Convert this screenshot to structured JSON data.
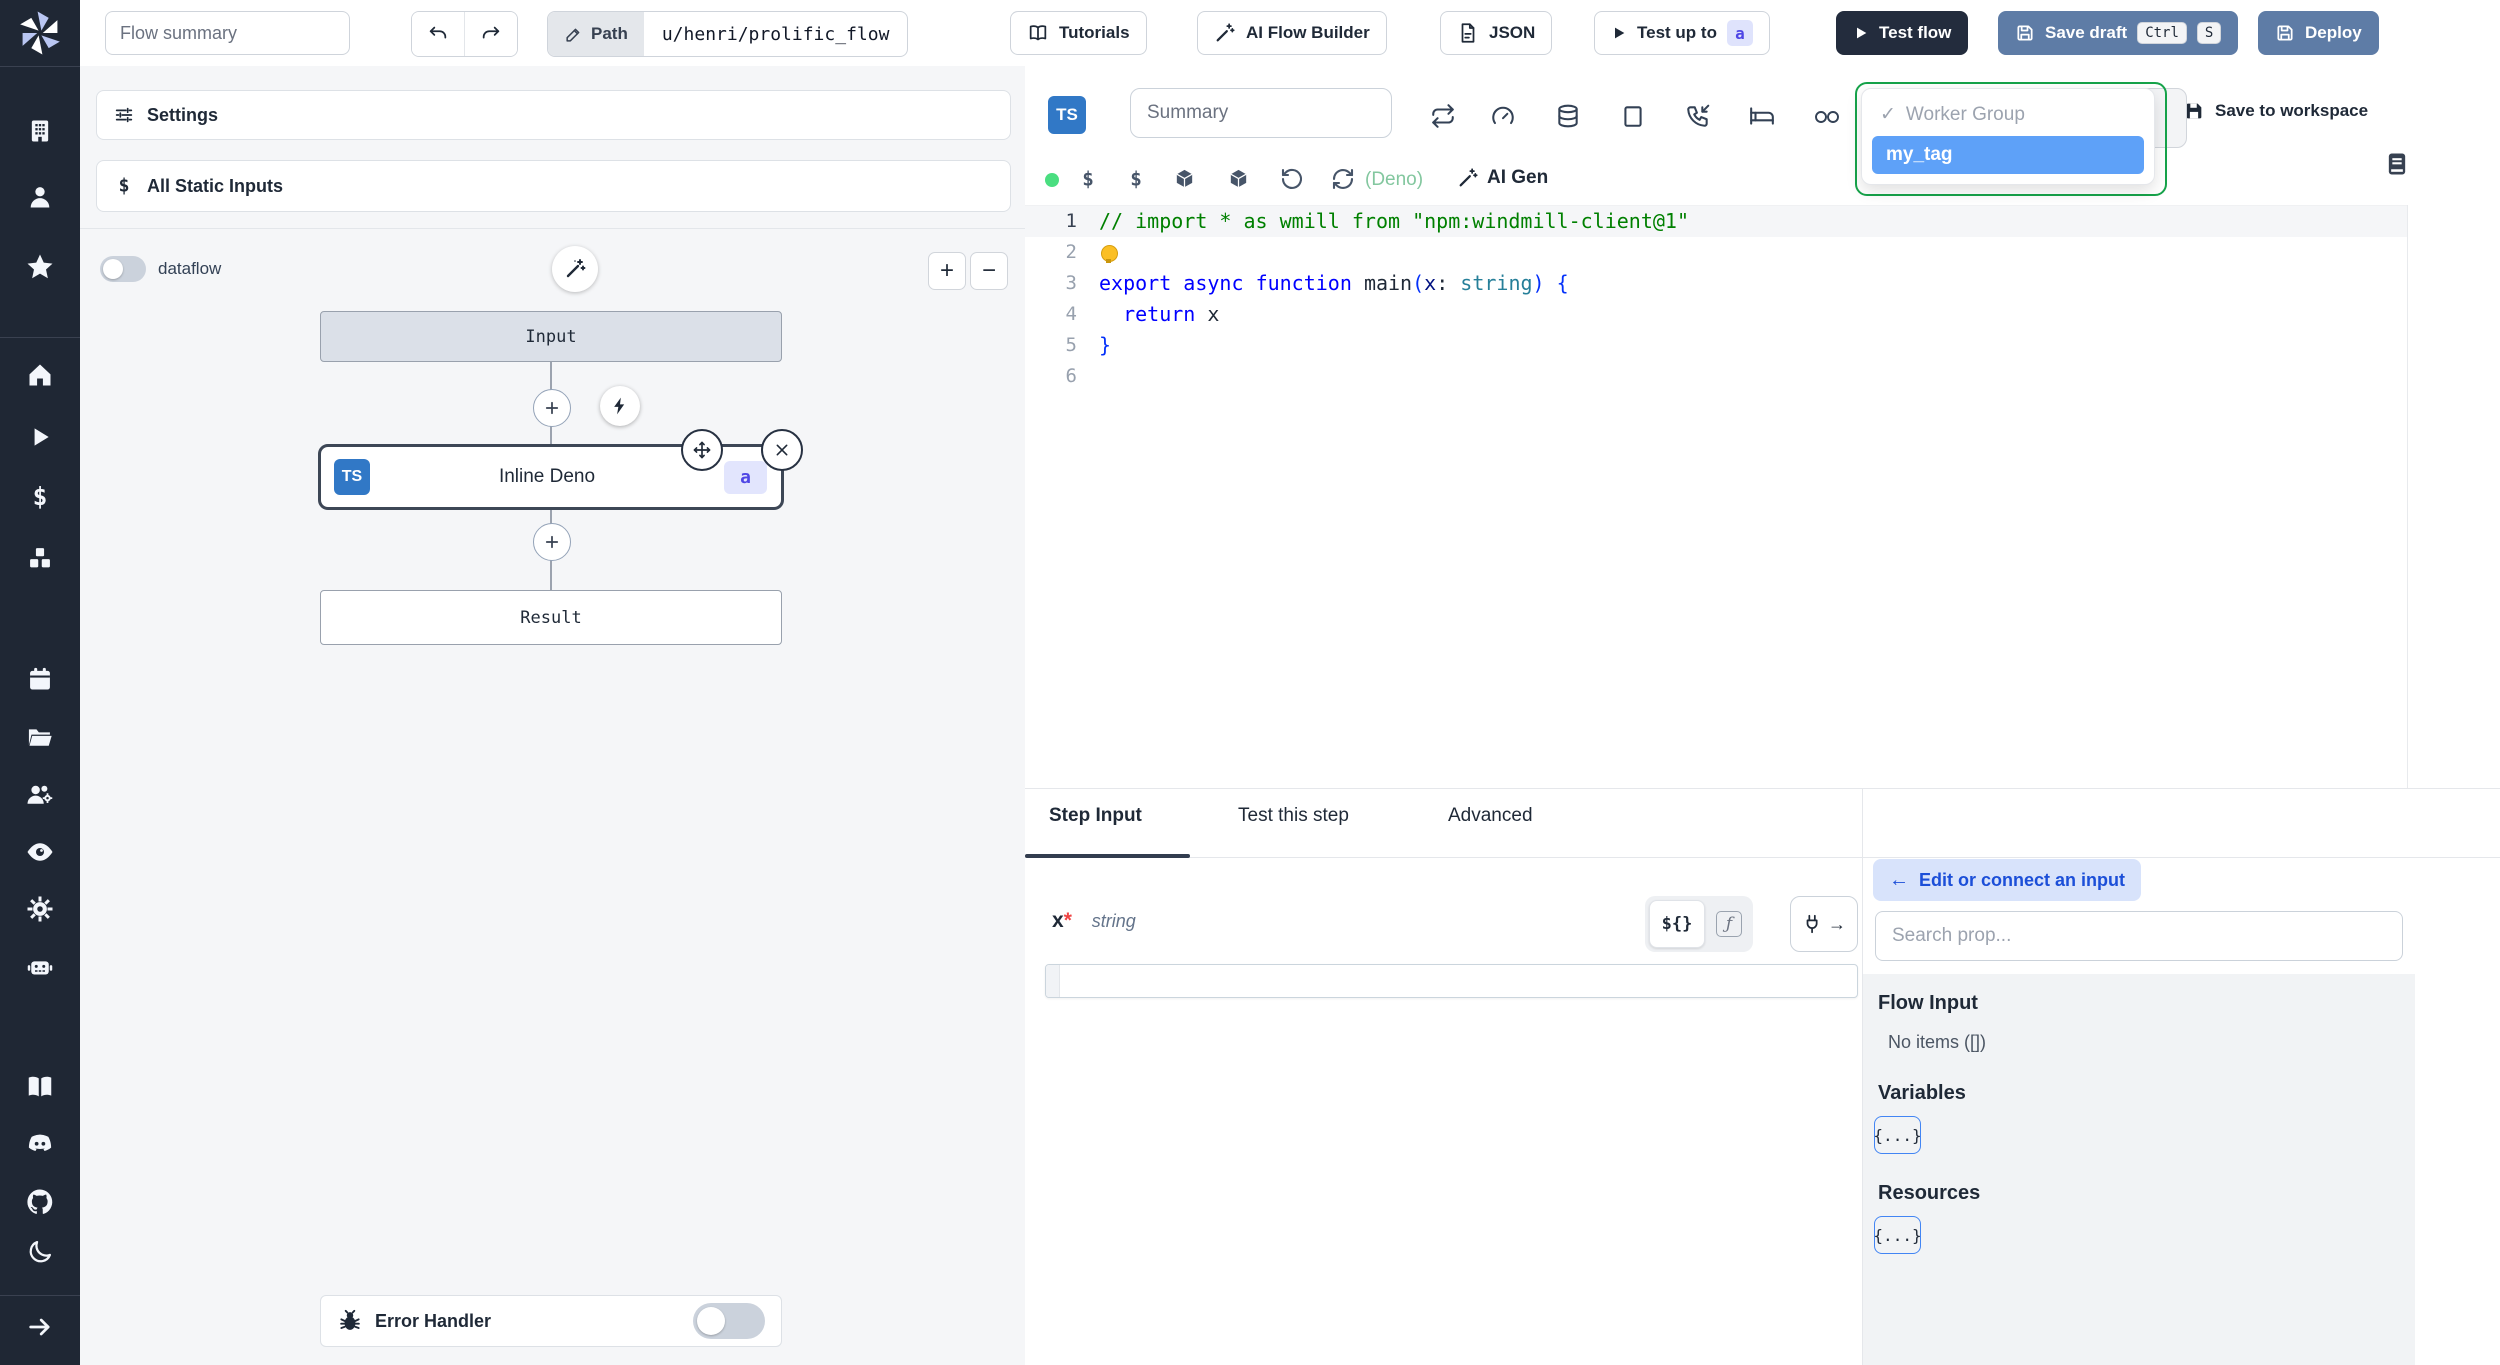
{
  "topbar": {
    "flow_summary_placeholder": "Flow summary",
    "path_label": "Path",
    "path_value": "u/henri/prolific_flow",
    "tutorials_label": "Tutorials",
    "ai_flow_builder_label": "AI Flow Builder",
    "json_label": "JSON",
    "test_up_to_label": "Test up to",
    "test_up_to_badge": "a",
    "test_flow_label": "Test flow",
    "save_draft_label": "Save draft",
    "save_draft_kbd": [
      "Ctrl",
      "S"
    ],
    "deploy_label": "Deploy"
  },
  "sidebar": {
    "icons": [
      "windmill-logo",
      "building",
      "user",
      "star",
      "home",
      "play",
      "dollar",
      "boxes",
      "calendar",
      "folder-open",
      "users-cog",
      "eye",
      "settings-gear",
      "robot",
      "book-open",
      "discord",
      "github",
      "moon",
      "arrow-right"
    ]
  },
  "flow_panel": {
    "settings_label": "Settings",
    "all_static_inputs_label": "All Static Inputs",
    "dataflow_label": "dataflow",
    "zoom_in": "+",
    "zoom_out": "−",
    "input_node": "Input",
    "step_node": "Inline Deno",
    "step_lang_badge": "TS",
    "step_id_badge": "a",
    "result_node": "Result",
    "error_handler_label": "Error Handler"
  },
  "editor": {
    "lang_badge": "TS",
    "summary_placeholder": "Summary",
    "toolbar_icons": [
      "repeat",
      "gauge",
      "database",
      "square",
      "phone-incoming",
      "bed",
      "infinity"
    ],
    "status_icons": [
      "green-dot",
      "dollar",
      "dollar",
      "cube",
      "cube",
      "rotate-ccw",
      "refresh"
    ],
    "runtime_label": "(Deno)",
    "ai_gen_label": "AI Gen",
    "save_to_workspace_label": "Save to workspace",
    "worker_group_dropdown": {
      "check": "✓",
      "header": "Worker Group",
      "selected": "my_tag"
    },
    "code": {
      "lines": [
        {
          "n": "1",
          "active": true,
          "tokens": [
            {
              "t": "// import * as wmill from \"npm:windmill-client@1\"",
              "c": "cm"
            }
          ]
        },
        {
          "n": "2",
          "bulb": true,
          "tokens": []
        },
        {
          "n": "3",
          "tokens": [
            {
              "t": "export",
              "c": "kw"
            },
            {
              "t": " ",
              "c": "df"
            },
            {
              "t": "async",
              "c": "kw"
            },
            {
              "t": " ",
              "c": "df"
            },
            {
              "t": "function",
              "c": "kw"
            },
            {
              "t": " ",
              "c": "df"
            },
            {
              "t": "main",
              "c": "fn"
            },
            {
              "t": "(",
              "c": "br"
            },
            {
              "t": "x",
              "c": "pm"
            },
            {
              "t": ": ",
              "c": "df"
            },
            {
              "t": "string",
              "c": "ty"
            },
            {
              "t": ")",
              "c": "br"
            },
            {
              "t": " ",
              "c": "df"
            },
            {
              "t": "{",
              "c": "br"
            }
          ]
        },
        {
          "n": "4",
          "tokens": [
            {
              "t": "  ",
              "c": "df"
            },
            {
              "t": "return",
              "c": "kw"
            },
            {
              "t": " x",
              "c": "df"
            }
          ]
        },
        {
          "n": "5",
          "tokens": [
            {
              "t": "}",
              "c": "br"
            }
          ]
        },
        {
          "n": "6",
          "tokens": []
        }
      ]
    }
  },
  "bottom": {
    "tabs": [
      {
        "label": "Step Input",
        "active": true
      },
      {
        "label": "Test this step"
      },
      {
        "label": "Advanced"
      }
    ],
    "field": {
      "name": "x",
      "required": "*",
      "type": "string"
    },
    "expr_toggle": {
      "template": "${}",
      "fn": "ƒ",
      "arrow": "→"
    },
    "prop_picker": {
      "back_arrow": "←",
      "edit_connect_label": "Edit or connect an input",
      "search_placeholder": "Search prop...",
      "flow_input_title": "Flow Input",
      "flow_input_empty": "No items ([])",
      "variables_title": "Variables",
      "variables_chip": "{...}",
      "resources_title": "Resources",
      "resources_chip": "{...}"
    }
  },
  "colors": {
    "sidebar_bg": "#1f2734",
    "slate_button": "#5e7ca6",
    "dark_button": "#232c3d",
    "selected_item_blue": "#5ea1f8",
    "dropdown_focus_green": "#16a34a",
    "badge_indigo_bg": "#dfe3fc",
    "badge_indigo_text": "#4f46e5",
    "deno_green": "#83c79f",
    "ts_badge_blue": "#3178c6",
    "comment_green": "#008000",
    "keyword_blue": "#0000ff"
  }
}
